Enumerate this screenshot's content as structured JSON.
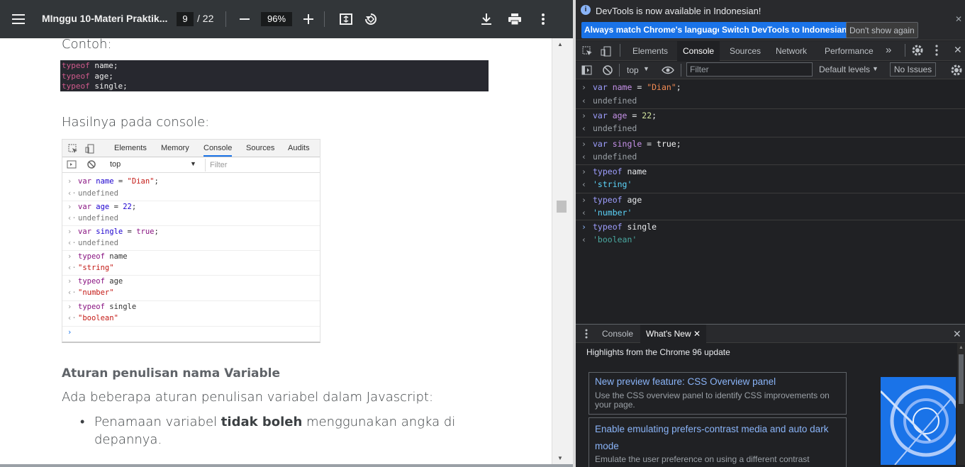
{
  "pdf": {
    "title": "MInggu 10-Materi Praktik...",
    "page_current": "9",
    "page_total": "/ 22",
    "zoom": "96%",
    "contoh_label": "Contoh:",
    "code_lines": [
      {
        "kw": "typeof",
        "rest": " name;"
      },
      {
        "kw": "typeof",
        "rest": " age;"
      },
      {
        "kw": "typeof",
        "rest": " single;"
      }
    ],
    "hasil_label": "Hasilnya pada console:",
    "embedded": {
      "tabs": [
        "Elements",
        "Memory",
        "Console",
        "Sources",
        "Audits"
      ],
      "context": "top",
      "filter": "Filter",
      "lines": [
        {
          "arrow": "›",
          "a": "var",
          "b": " name",
          "c": " = ",
          "d": "\"Dian\"",
          "e": ";"
        },
        {
          "arrow": "‹·",
          "out": "undefined"
        },
        {
          "arrow": "›",
          "a": "var",
          "b": " age",
          "c": " = ",
          "d": "22",
          "e": ";"
        },
        {
          "arrow": "‹·",
          "out": "undefined"
        },
        {
          "arrow": "›",
          "a": "var",
          "b": " single",
          "c": " = ",
          "d": "true",
          "e": ";"
        },
        {
          "arrow": "‹·",
          "out": "undefined"
        },
        {
          "arrow": "›",
          "a": "typeof",
          "b": " name",
          "c": "",
          "d": "",
          "e": ""
        },
        {
          "arrow": "‹·",
          "str": "\"string\""
        },
        {
          "arrow": "›",
          "a": "typeof",
          "b": " age",
          "c": "",
          "d": "",
          "e": ""
        },
        {
          "arrow": "‹·",
          "str": "\"number\""
        },
        {
          "arrow": "›",
          "a": "typeof",
          "b": " single",
          "c": "",
          "d": "",
          "e": ""
        },
        {
          "arrow": "‹·",
          "str": "\"boolean\""
        },
        {
          "arrow": "›"
        }
      ]
    },
    "heading": "Aturan penulisan nama Variable",
    "paragraph": "Ada beberapa aturan penulisan variabel dalam Javascript:",
    "bullet_pre": "Penamaan variabel ",
    "bullet_bold": "tidak boleh",
    "bullet_post": " menggunakan angka di",
    "bullet_line2": "depannya."
  },
  "devtools": {
    "info_text": "DevTools is now available in Indonesian!",
    "btn_match": "Always match Chrome's language",
    "btn_switch": "Switch DevTools to Indonesian",
    "btn_dont": "Don't show again",
    "tabs": [
      "Elements",
      "Console",
      "Sources",
      "Network",
      "Performance"
    ],
    "more": "»",
    "context": "top",
    "filter_placeholder": "Filter",
    "levels": "Default levels",
    "issues": "No Issues",
    "console": [
      {
        "type": "in",
        "kw": "var",
        "name": " name",
        "eq": " = ",
        "val": "\"Dian\"",
        "end": ";"
      },
      {
        "type": "out",
        "text": "undefined"
      },
      {
        "type": "in",
        "kw": "var",
        "name": " age",
        "eq": " = ",
        "val": "22",
        "end": ";"
      },
      {
        "type": "out",
        "text": "undefined"
      },
      {
        "type": "in",
        "kw": "var",
        "name": " single",
        "eq": " = ",
        "val": "true",
        "end": ";"
      },
      {
        "type": "out",
        "text": "undefined"
      },
      {
        "type": "in",
        "kw": "typeof",
        "name": " name",
        "eq": "",
        "val": "",
        "end": ""
      },
      {
        "type": "str",
        "text": "'string'"
      },
      {
        "type": "in",
        "kw": "typeof",
        "name": " age",
        "eq": "",
        "val": "",
        "end": ""
      },
      {
        "type": "str",
        "text": "'number'"
      },
      {
        "type": "in",
        "kw": "typeof",
        "name": " single",
        "eq": "",
        "val": "",
        "end": ""
      },
      {
        "type": "str",
        "text": "'boolean'"
      }
    ],
    "drawer_console": "Console",
    "drawer_whatsnew": "What's New",
    "highlights": "Highlights from the Chrome 96 update",
    "card1_title": "New preview feature: CSS Overview panel",
    "card1_desc": "Use the CSS overview panel to identify CSS improvements on your page.",
    "card2_title": "Enable emulating prefers-contrast media and auto dark mode",
    "card2_desc": "Emulate the user preference on using a different contrast"
  }
}
